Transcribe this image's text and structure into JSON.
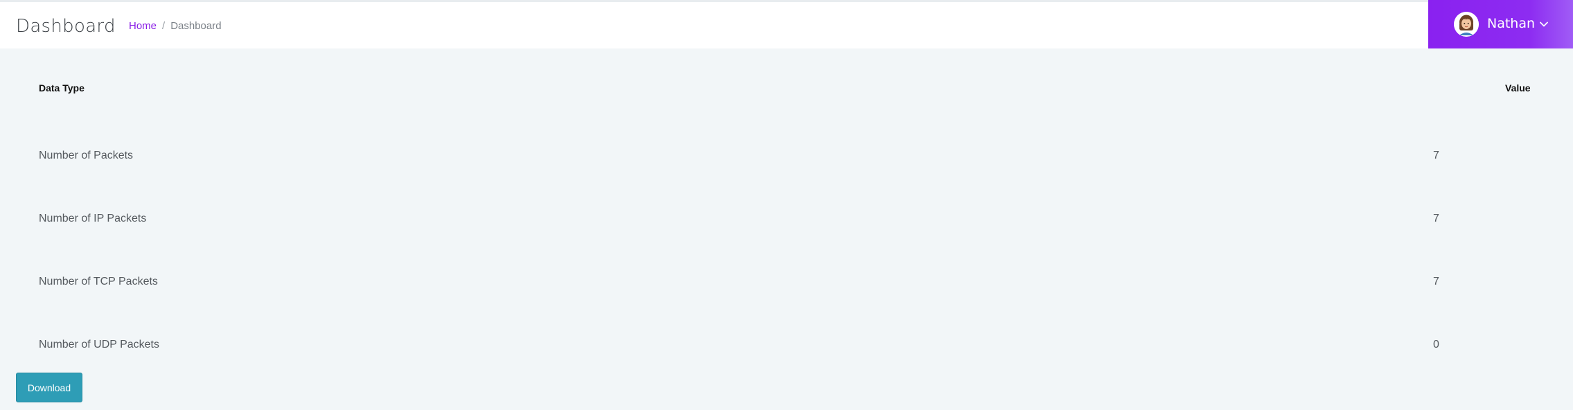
{
  "header": {
    "title": "Dashboard",
    "breadcrumb": {
      "home": "Home",
      "separator": "/",
      "current": "Dashboard"
    },
    "user": {
      "name": "Nathan",
      "avatar_icon": "user-avatar-icon",
      "menu_icon": "chevron-down-icon"
    },
    "accent_color": "#8a21f0"
  },
  "table": {
    "columns": [
      "Data Type",
      "Value"
    ],
    "rows": [
      {
        "type": "Number of Packets",
        "value": "7"
      },
      {
        "type": "Number of IP Packets",
        "value": "7"
      },
      {
        "type": "Number of TCP Packets",
        "value": "7"
      },
      {
        "type": "Number of UDP Packets",
        "value": "0"
      }
    ]
  },
  "actions": {
    "download_label": "Download",
    "download_color": "#2e9db6"
  }
}
